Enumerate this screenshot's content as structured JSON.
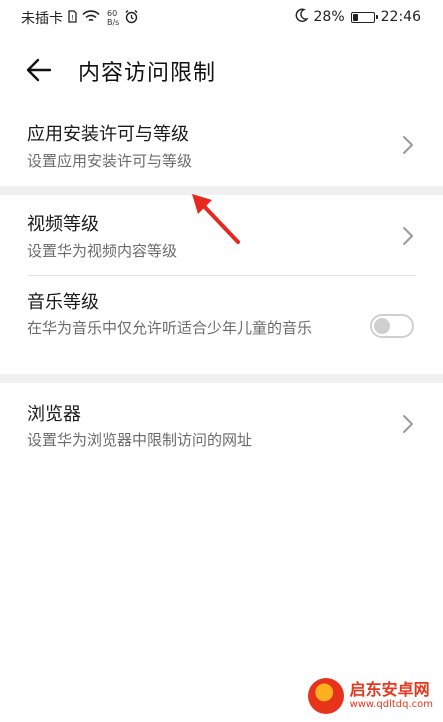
{
  "status_bar": {
    "carrier": "未插卡",
    "speed_value": "60",
    "speed_unit": "B/s",
    "battery": "28%",
    "battery_level": 0.28,
    "time": "22:46"
  },
  "header": {
    "title": "内容访问限制"
  },
  "items": [
    {
      "title": "应用安装许可与等级",
      "subtitle": "设置应用安装许可与等级",
      "control": "chevron"
    },
    {
      "title": "视频等级",
      "subtitle": "设置华为视频内容等级",
      "control": "chevron"
    },
    {
      "title": "音乐等级",
      "subtitle": "在华为音乐中仅允许听适合少年儿童的音乐",
      "control": "toggle",
      "toggle_on": false
    },
    {
      "title": "浏览器",
      "subtitle": "设置华为浏览器中限制访问的网址",
      "control": "chevron"
    }
  ],
  "watermark": {
    "name": "启东安卓网",
    "url": "www.qdltdq.com"
  },
  "colors": {
    "annotation_arrow": "#e8271f",
    "watermark": "#e4371f"
  }
}
